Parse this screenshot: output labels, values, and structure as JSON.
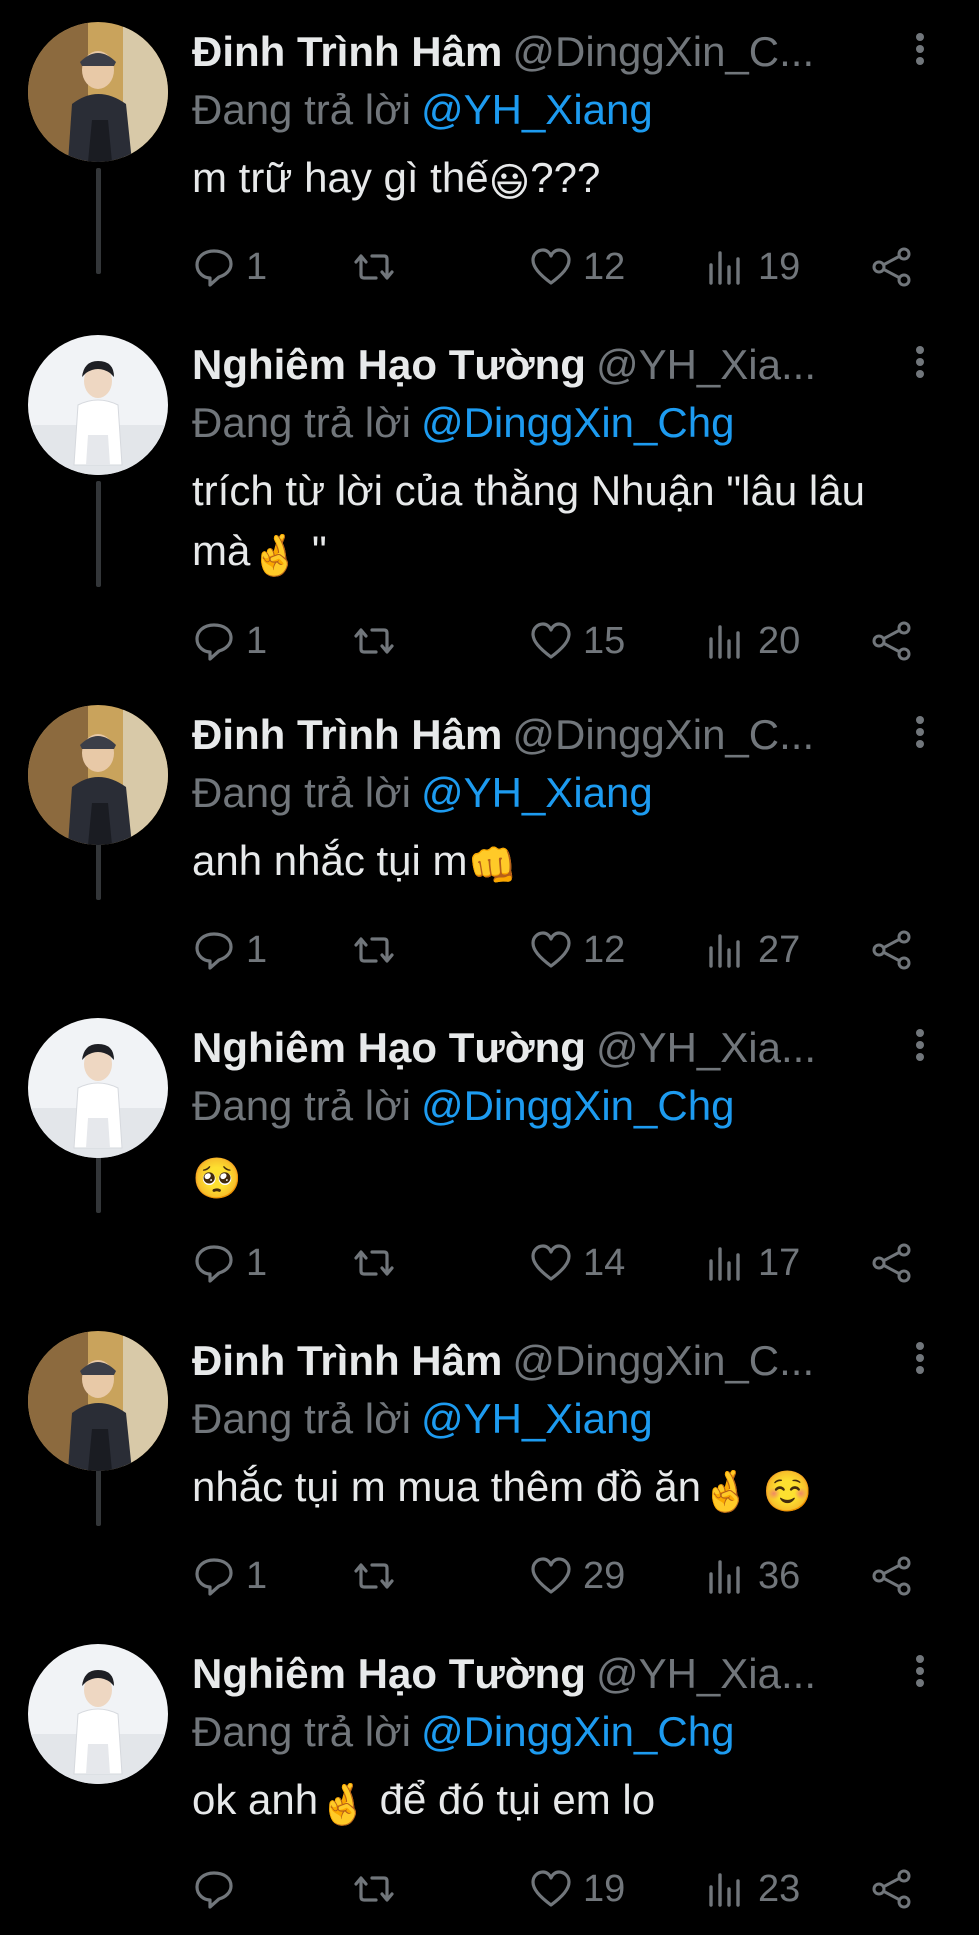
{
  "reply_prefix": "Đang trả lời",
  "accent_color": "#1d9bf0",
  "muted_color": "#71767b",
  "tweets": [
    {
      "name": "Đinh Trình Hâm",
      "handle": "@DinggXin_C...",
      "replying_to": "@YH_Xiang",
      "text": "m trữ hay gì thế",
      "text_after": "???",
      "emoji": "😃",
      "emoji_b": "",
      "text_tail": "",
      "replies": "1",
      "retweets": "",
      "likes": "12",
      "views": "19",
      "avatar_icon": "avatar-dark-outfit"
    },
    {
      "name": "Nghiêm Hạo Tường",
      "handle": "@YH_Xia...",
      "replying_to": "@DinggXin_Chg",
      "text": "trích từ lời của thằng Nhuận \"lâu lâu mà",
      "text_after": " \"",
      "emoji": "🤞",
      "emoji_b": "",
      "text_tail": "",
      "replies": "1",
      "retweets": "",
      "likes": "15",
      "views": "20",
      "avatar_icon": "avatar-light-outfit"
    },
    {
      "name": "Đinh Trình Hâm",
      "handle": "@DinggXin_C...",
      "replying_to": "@YH_Xiang",
      "text": "anh nhắc tụi m",
      "text_after": "",
      "emoji": "👊",
      "emoji_b": "",
      "text_tail": "",
      "replies": "1",
      "retweets": "",
      "likes": "12",
      "views": "27",
      "avatar_icon": "avatar-dark-outfit"
    },
    {
      "name": "Nghiêm Hạo Tường",
      "handle": "@YH_Xia...",
      "replying_to": "@DinggXin_Chg",
      "text": "",
      "text_after": "",
      "emoji": "🥺",
      "emoji_b": "",
      "text_tail": "",
      "replies": "1",
      "retweets": "",
      "likes": "14",
      "views": "17",
      "avatar_icon": "avatar-light-outfit"
    },
    {
      "name": "Đinh Trình Hâm",
      "handle": "@DinggXin_C...",
      "replying_to": "@YH_Xiang",
      "text": "nhắc tụi m mua thêm đồ ăn",
      "text_after": "",
      "emoji": "🤞",
      "emoji_b": "☺️",
      "text_tail": "",
      "replies": "1",
      "retweets": "",
      "likes": "29",
      "views": "36",
      "avatar_icon": "avatar-dark-outfit"
    },
    {
      "name": "Nghiêm Hạo Tường",
      "handle": "@YH_Xia...",
      "replying_to": "@DinggXin_Chg",
      "text": "ok anh",
      "text_after": "",
      "emoji": "🤞",
      "emoji_b": "",
      "text_tail": " để đó tụi em lo",
      "replies": "",
      "retweets": "",
      "likes": "19",
      "views": "23",
      "avatar_icon": "avatar-light-outfit"
    }
  ]
}
